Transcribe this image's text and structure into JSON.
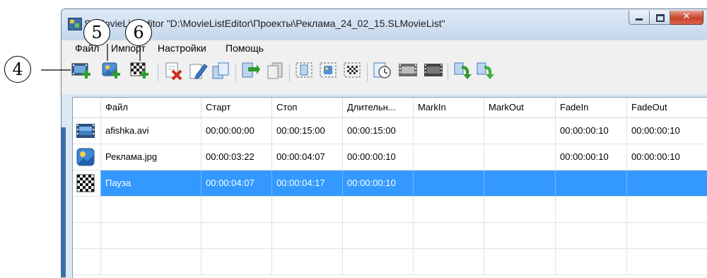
{
  "window": {
    "title": "SLMovieListEditor \"D:\\MovieListEditor\\Проекты\\Реклама_24_02_15.SLMovieList\"",
    "close_glyph": "✕"
  },
  "menu": [
    "Файл",
    "Импорт",
    "Настройки",
    "Помощь"
  ],
  "callouts": [
    "4",
    "5",
    "6"
  ],
  "toolbar_icons": [
    "add-video-icon",
    "add-image-icon",
    "add-pause-icon",
    "delete-icon",
    "edit-icon",
    "copy-icon",
    "move-down-icon",
    "move-up-icon",
    "mark-in-icon",
    "mark-out-icon",
    "checker-icon",
    "clock-icon",
    "film-icon",
    "film-dark-icon",
    "sort-down-icon",
    "sort-up-icon"
  ],
  "table": {
    "columns": [
      "Файл",
      "Старт",
      "Стоп",
      "Длительн...",
      "MarkIn",
      "MarkOut",
      "FadeIn",
      "FadeOut"
    ],
    "rows": [
      {
        "icon": "video-file-icon",
        "file": "afishka.avi",
        "start": "00:00:00:00",
        "stop": "00:00:15:00",
        "duration": "00:00:15:00",
        "markin": "",
        "markout": "",
        "fadein": "00:00:00:10",
        "fadeout": "00:00:00:10",
        "selected": false
      },
      {
        "icon": "image-file-icon",
        "file": "Реклама.jpg",
        "start": "00:00:03:22",
        "stop": "00:00:04:07",
        "duration": "00:00:00:10",
        "markin": "",
        "markout": "",
        "fadein": "00:00:00:10",
        "fadeout": "00:00:00:10",
        "selected": false
      },
      {
        "icon": "pause-checker-icon",
        "file": "Пауза",
        "start": "00:00:04:07",
        "stop": "00:00:04:17",
        "duration": "00:00:00:10",
        "markin": "",
        "markout": "",
        "fadein": "",
        "fadeout": "",
        "selected": true
      }
    ]
  },
  "colors": {
    "selection": "#3399ff",
    "window_frame": "#c4d7ec",
    "accent_blue": "#3b6ea5"
  }
}
